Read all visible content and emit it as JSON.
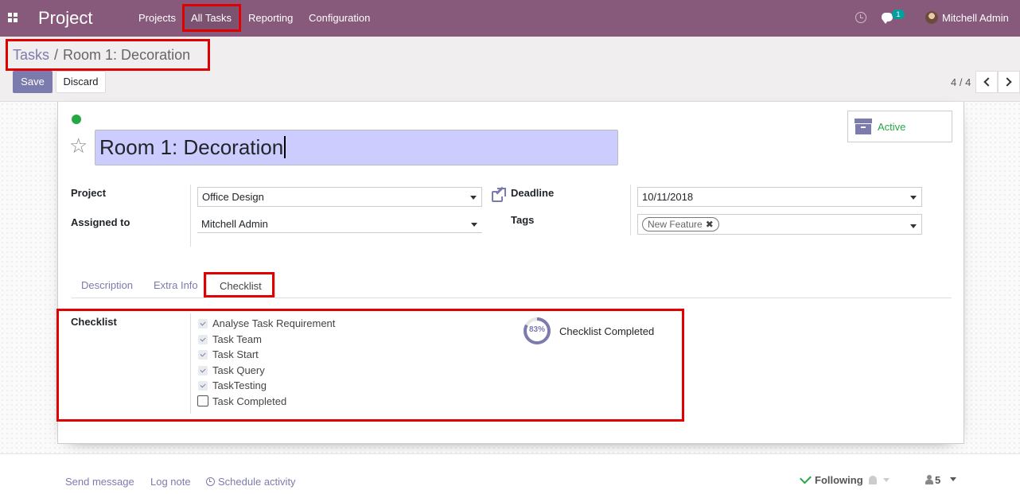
{
  "navbar": {
    "brand": "Project",
    "menu": [
      "Projects",
      "All Tasks",
      "Reporting",
      "Configuration"
    ],
    "message_count": "1",
    "user_name": "Mitchell Admin",
    "color": "#875A7B"
  },
  "breadcrumb": {
    "parent": "Tasks",
    "separator": "/",
    "current": "Room 1: Decoration"
  },
  "actions": {
    "save_label": "Save",
    "discard_label": "Discard"
  },
  "pager": {
    "value": "4 / 4"
  },
  "task": {
    "title": "Room 1: Decoration",
    "status_color": "#28a745",
    "active_label": "Active"
  },
  "fields": {
    "project_label": "Project",
    "project_value": "Office Design",
    "assigned_label": "Assigned to",
    "assigned_value": "Mitchell Admin",
    "deadline_label": "Deadline",
    "deadline_value": "10/11/2018",
    "tags_label": "Tags",
    "tags": [
      "New Feature"
    ]
  },
  "tabs": [
    "Description",
    "Extra Info",
    "Checklist"
  ],
  "checklist": {
    "label": "Checklist",
    "items": [
      {
        "label": "Analyse Task Requirement",
        "checked": true
      },
      {
        "label": "Task Team",
        "checked": true
      },
      {
        "label": "Task Start",
        "checked": true
      },
      {
        "label": "Task Query",
        "checked": true
      },
      {
        "label": "TaskTesting",
        "checked": true
      },
      {
        "label": "Task Completed",
        "checked": false
      }
    ],
    "progress_percent": 83,
    "progress_text": "83%",
    "progress_label": "Checklist Completed"
  },
  "chatter": {
    "send_message": "Send message",
    "log_note": "Log note",
    "schedule_activity": "Schedule activity",
    "following": "Following",
    "followers": "5"
  },
  "colors": {
    "accent": "#7C7BAD",
    "highlight": "#e00000",
    "title_bg": "#ccccff"
  }
}
